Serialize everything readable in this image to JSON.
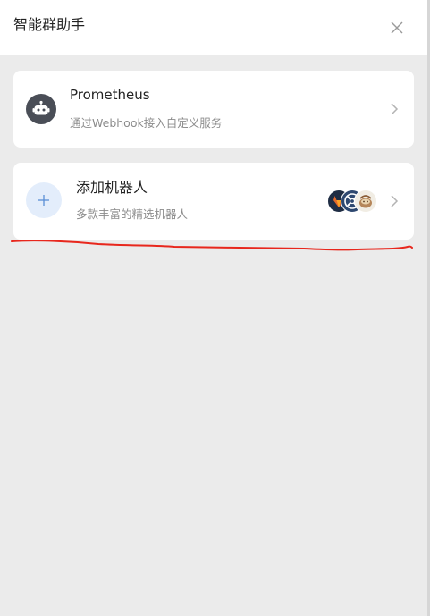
{
  "header": {
    "title": "智能群助手",
    "close_icon": "close-icon"
  },
  "cards": [
    {
      "title": "Prometheus",
      "subtitle": "通过Webhook接入自定义服务",
      "icon": "robot-icon",
      "chevron_icon": "chevron-right-icon"
    },
    {
      "title": "添加机器人",
      "subtitle": "多款丰富的精选机器人",
      "icon": "plus-icon",
      "avatars": [
        "gitlab-icon",
        "jenkins-icon",
        "bot-icon"
      ],
      "chevron_icon": "chevron-right-icon"
    }
  ],
  "colors": {
    "background": "#ebebeb",
    "card": "#ffffff",
    "robot_avatar": "#4a4e57",
    "plus_avatar": "#e3edfb",
    "plus_glyph": "#5b8fd6",
    "annotation_line": "#e8271d"
  }
}
